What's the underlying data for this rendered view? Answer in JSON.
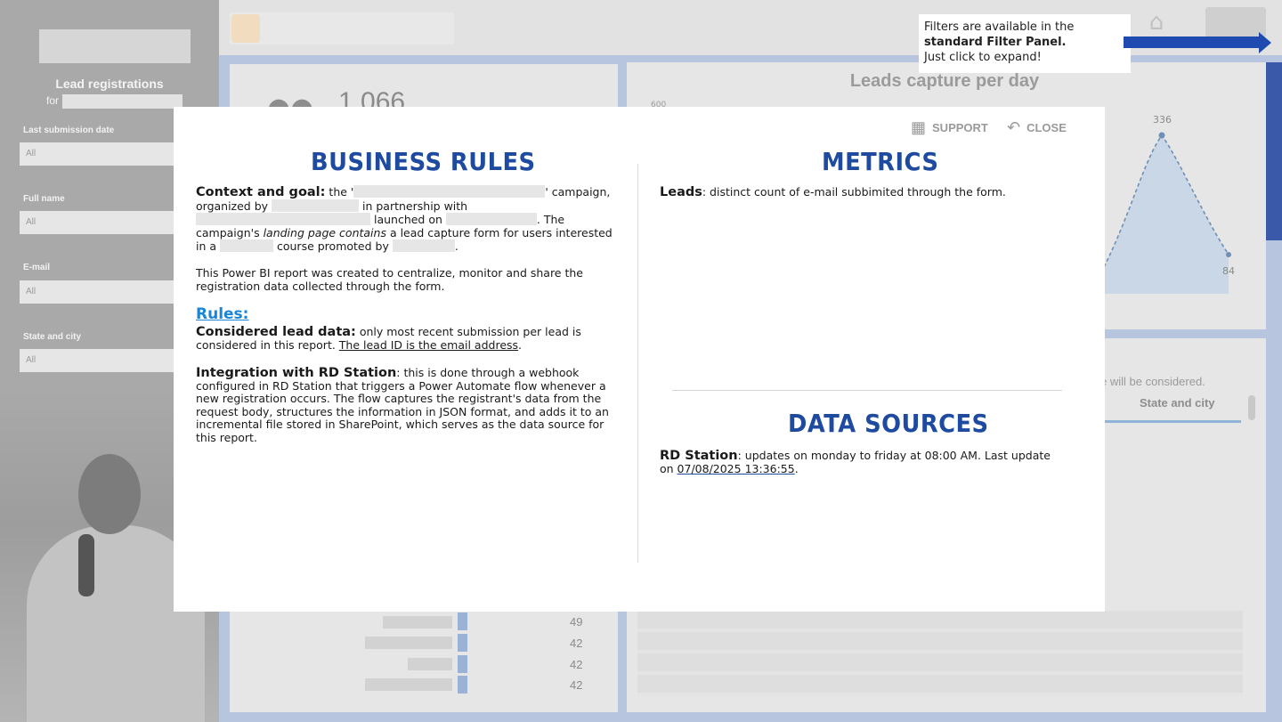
{
  "sidebar": {
    "title": "Lead registrations",
    "for_prefix": "for",
    "filters": [
      {
        "label": "Last submission date",
        "value": "All"
      },
      {
        "label": "Full name",
        "value": "All"
      },
      {
        "label": "E-mail",
        "value": "All"
      },
      {
        "label": "State and city",
        "value": "All"
      }
    ]
  },
  "background": {
    "kpi_value": "1,066",
    "chart_title": "Leads capture per day",
    "chart_y_top": "600",
    "chart_peak_label": "336",
    "chart_end_label": "84",
    "table_note": "e will be considered.",
    "table_header": "State and city",
    "bar_values": [
      "49",
      "42",
      "42",
      "42"
    ]
  },
  "tooltip": {
    "line1": "Filters are available in the",
    "line2": "standard Filter Panel.",
    "line3": "Just click to expand!"
  },
  "modal": {
    "support_label": "SUPPORT",
    "close_label": "CLOSE",
    "business_rules": {
      "title": "BUSINESS RULES",
      "context_heading": "Context and goal:",
      "context_t1": " the '",
      "context_t2": "' campaign, organized by ",
      "context_t3": " in partnership with ",
      "context_t4": " launched on ",
      "context_t5": ". The campaign's ",
      "context_italic": "landing page contains",
      "context_t6": " a lead capture form for users interested in a ",
      "context_t7": " course promoted by ",
      "context_t8": ".",
      "purpose": "This Power BI report was created to centralize, monitor and share the registration data collected through the form.",
      "rules_label": "Rules:",
      "considered_heading": "Considered lead data:",
      "considered_text": " only most recent submission per lead is considered in this report. ",
      "considered_underline": "The lead ID is the email address",
      "considered_end": ".",
      "integration_heading": "Integration with RD Station",
      "integration_text": ": this is done through a webhook configured in RD Station that triggers a Power Automate flow whenever a new registration occurs. The flow captures the registrant's data from the request body, structures the information in JSON format, and adds it to an incremental file stored in SharePoint, which serves as the data source for this report."
    },
    "metrics": {
      "title": "METRICS",
      "leads_heading": "Leads",
      "leads_text": ": distinct count of e-mail subbimited through the form."
    },
    "data_sources": {
      "title": "DATA SOURCES",
      "rd_heading": "RD Station",
      "rd_text": ": updates on monday to friday at 08:00 AM. Last update on ",
      "rd_date": "07/08/2025 13:36:55",
      "rd_end": "."
    }
  }
}
